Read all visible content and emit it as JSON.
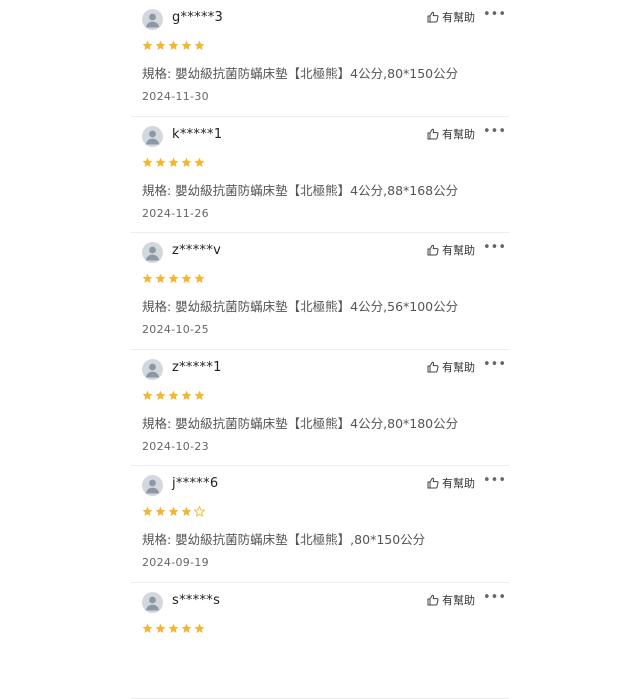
{
  "colors": {
    "star_filled": "#f5b52e",
    "star_empty": "#c9c9c9",
    "avatar_bg": "#d3d8de"
  },
  "reviews": [
    {
      "user": "g*****3",
      "rating": 5,
      "helpful_label": "有幫助",
      "more_label": "•••",
      "spec": "規格: 嬰幼級抗菌防蟎床墊【北極熊】4公分,80*150公分",
      "date": "2024-11-30"
    },
    {
      "user": "k*****1",
      "rating": 5,
      "helpful_label": "有幫助",
      "more_label": "•••",
      "spec": "規格: 嬰幼級抗菌防蟎床墊【北極熊】4公分,88*168公分",
      "date": "2024-11-26"
    },
    {
      "user": "z*****v",
      "rating": 5,
      "helpful_label": "有幫助",
      "more_label": "•••",
      "spec": "規格: 嬰幼級抗菌防蟎床墊【北極熊】4公分,56*100公分",
      "date": "2024-10-25"
    },
    {
      "user": "z*****1",
      "rating": 5,
      "helpful_label": "有幫助",
      "more_label": "•••",
      "spec": "規格: 嬰幼級抗菌防蟎床墊【北極熊】4公分,80*180公分",
      "date": "2024-10-23"
    },
    {
      "user": "j*****6",
      "rating": 4,
      "helpful_label": "有幫助",
      "more_label": "•••",
      "spec": "規格: 嬰幼級抗菌防蟎床墊【北極熊】,80*150公分",
      "date": "2024-09-19"
    },
    {
      "user": "s*****s",
      "rating": 5,
      "helpful_label": "有幫助",
      "more_label": "•••",
      "spec": "",
      "date": ""
    }
  ]
}
